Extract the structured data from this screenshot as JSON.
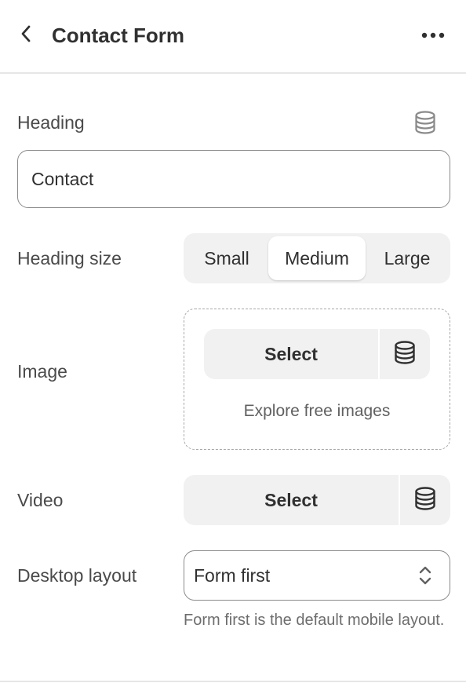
{
  "header": {
    "title": "Contact Form",
    "back_icon": "chevron-left-icon",
    "more_icon": "ellipsis-icon"
  },
  "heading": {
    "label": "Heading",
    "value": "Contact",
    "source_icon": "database-icon"
  },
  "heading_size": {
    "label": "Heading size",
    "options": [
      "Small",
      "Medium",
      "Large"
    ],
    "selected": "Medium"
  },
  "image": {
    "label": "Image",
    "select_label": "Select",
    "source_icon": "database-icon",
    "explore_label": "Explore free images"
  },
  "video": {
    "label": "Video",
    "select_label": "Select",
    "source_icon": "database-icon"
  },
  "desktop_layout": {
    "label": "Desktop layout",
    "value": "Form first",
    "help_text": "Form first is the default mobile layout."
  },
  "colors": {
    "text": "#303030",
    "muted": "#616161",
    "surface": "#f1f1f1",
    "border": "#8a8a8a"
  }
}
